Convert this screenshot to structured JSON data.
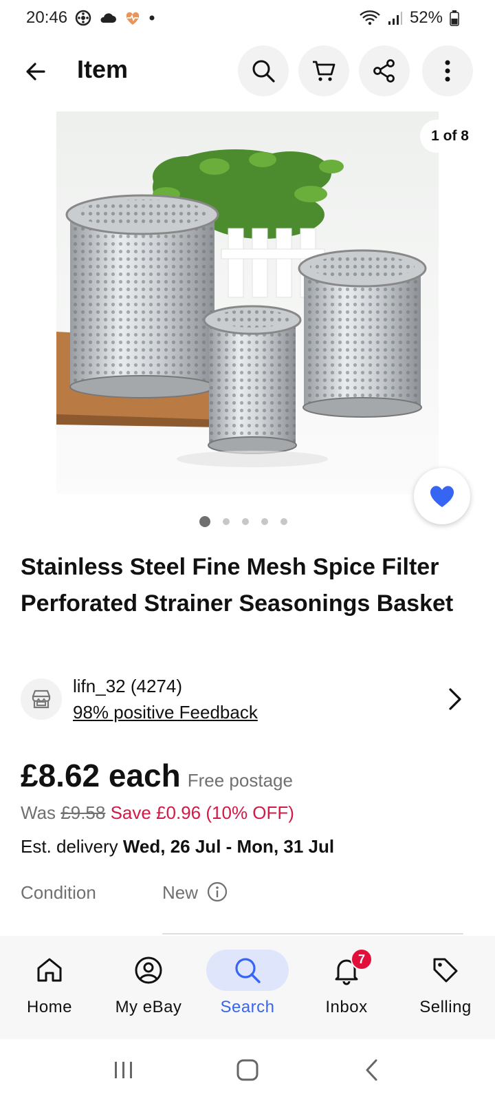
{
  "status_bar": {
    "time": "20:46",
    "battery": "52%"
  },
  "app_bar": {
    "title": "Item"
  },
  "gallery": {
    "counter": "1 of 8",
    "dots": 5,
    "active_dot": 0
  },
  "item": {
    "title": "Stainless Steel Fine Mesh Spice Filter Perforated Strainer Seasonings Basket"
  },
  "seller": {
    "name": "lifn_32 (4274)",
    "feedback": "98% positive Feedback"
  },
  "pricing": {
    "price": "£8.62 each",
    "postage": "Free postage",
    "was_label": "Was",
    "was_price": "£9.58",
    "save": "Save £0.96 (10% OFF)",
    "delivery_label": "Est. delivery",
    "delivery_dates": "Wed, 26 Jul - Mon, 31 Jul"
  },
  "condition": {
    "label": "Condition",
    "value": "New"
  },
  "bottom_nav": {
    "items": [
      {
        "label": "Home"
      },
      {
        "label": "My eBay"
      },
      {
        "label": "Search"
      },
      {
        "label": "Inbox",
        "badge": "7"
      },
      {
        "label": "Selling"
      }
    ],
    "active": "Search"
  },
  "colors": {
    "accent": "#3665f3",
    "sale": "#d11a46",
    "badge": "#e0103a"
  }
}
